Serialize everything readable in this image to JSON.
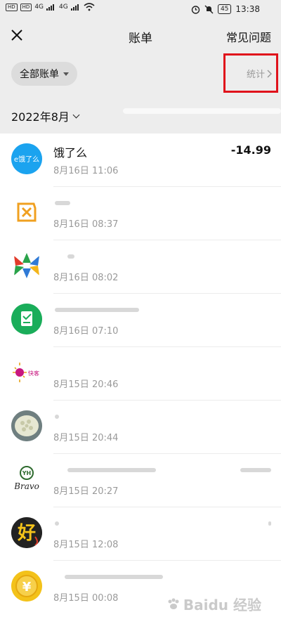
{
  "status": {
    "left_indicators": [
      "HD",
      "HD",
      "4G",
      "4G"
    ],
    "battery": "45",
    "time": "13:38"
  },
  "nav": {
    "title": "账单",
    "faq": "常见问题"
  },
  "filter": {
    "all_bills": "全部账单",
    "stats": "统计"
  },
  "month": {
    "label": "2022年8月"
  },
  "transactions": [
    {
      "name": "饿了么",
      "time": "8月16日 11:06",
      "amount": "-14.99",
      "icon": "eleme-logo-icon",
      "icon_color": "#1ba3ef"
    },
    {
      "name": "",
      "time": "8月16日 08:37",
      "amount": "",
      "icon": "store-ticket-icon",
      "icon_color": "#f0a020"
    },
    {
      "name": "",
      "time": "8月16日 08:02",
      "amount": "",
      "icon": "colorful-arrows-logo-icon",
      "icon_color": "#2a8f3a"
    },
    {
      "name": "",
      "time": "8月16日 07:10",
      "amount": "",
      "icon": "green-document-icon",
      "icon_color": "#1aad5a"
    },
    {
      "name": "",
      "time": "8月15日 20:46",
      "amount": "",
      "icon": "kuaike-logo-icon",
      "icon_color": "#c8177f"
    },
    {
      "name": "",
      "time": "8月15日 20:44",
      "amount": "",
      "icon": "food-plate-icon",
      "icon_color": "#7f8f90"
    },
    {
      "name": "",
      "time": "8月15日 20:27",
      "amount": "",
      "icon": "yh-bravo-logo-icon",
      "icon_color": "#2e6b2e"
    },
    {
      "name": "",
      "time": "8月15日 12:08",
      "amount": "",
      "icon": "hao-character-icon",
      "icon_color": "#222222"
    },
    {
      "name": "",
      "time": "8月15日 00:08",
      "amount": "",
      "icon": "yuan-coin-icon",
      "icon_color": "#f3c21a"
    }
  ],
  "watermark": "Baidu 经验"
}
